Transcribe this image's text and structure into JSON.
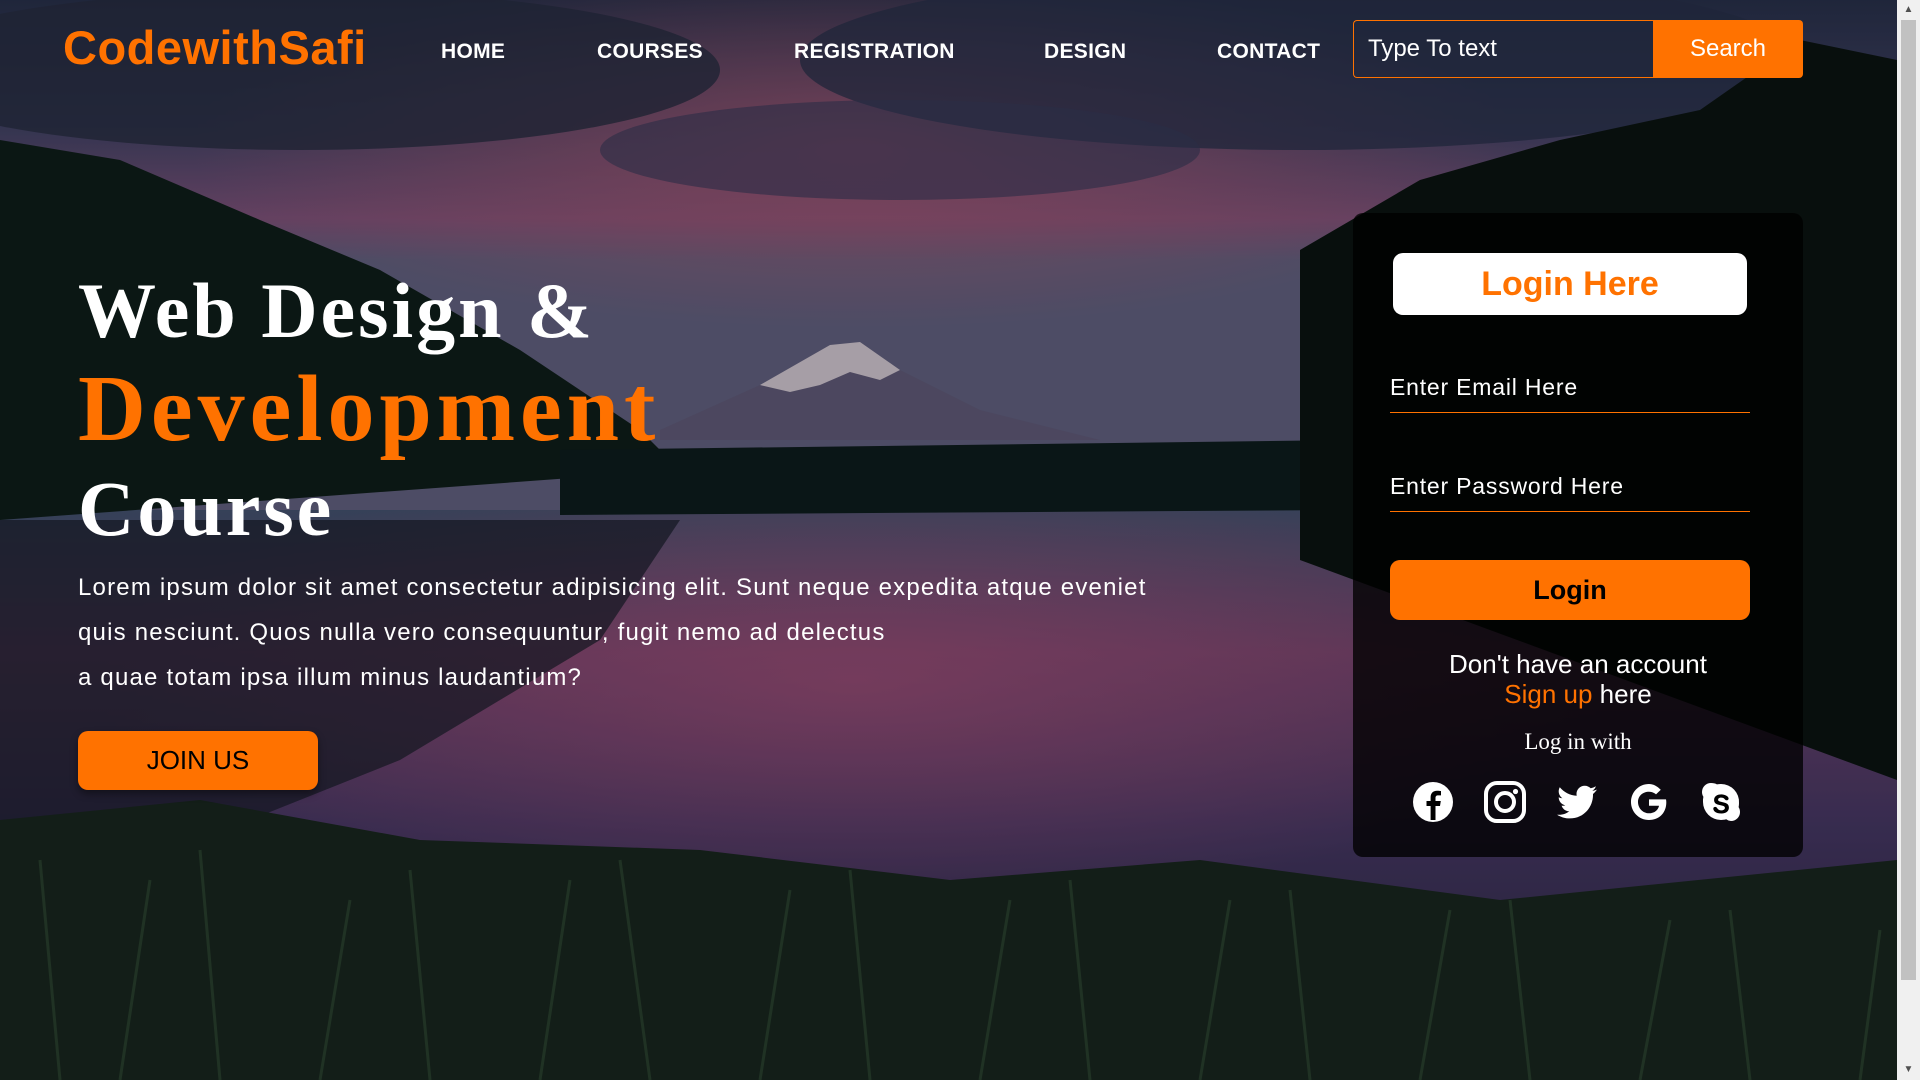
{
  "brand": {
    "name": "CodewithSafi",
    "accent": "#ff7200"
  },
  "nav": {
    "items": [
      "HOME",
      "COURSES",
      "REGISTRATION",
      "DESIGN",
      "CONTACT"
    ]
  },
  "search": {
    "placeholder": "Type To text",
    "button_label": "Search"
  },
  "hero": {
    "line1": "Web Design &",
    "line2": "Development",
    "line3": "Course",
    "paragraph": [
      "Lorem ipsum dolor sit amet consectetur adipisicing elit. Sunt neque expedita atque eveniet",
      "quis nesciunt. Quos nulla vero consequuntur, fugit nemo ad delectus",
      "a quae totam ipsa illum minus laudantium?"
    ],
    "cta_label": "JOIN US"
  },
  "login": {
    "title": "Login Here",
    "email_placeholder": "Enter Email Here",
    "password_placeholder": "Enter Password Here",
    "button_label": "Login",
    "no_account": "Don't have an account",
    "signup_link": "Sign up",
    "signup_suffix": " here",
    "log_in_with": "Log in with",
    "social_icons": [
      "facebook-icon",
      "instagram-icon",
      "twitter-icon",
      "google-icon",
      "skype-icon"
    ]
  }
}
